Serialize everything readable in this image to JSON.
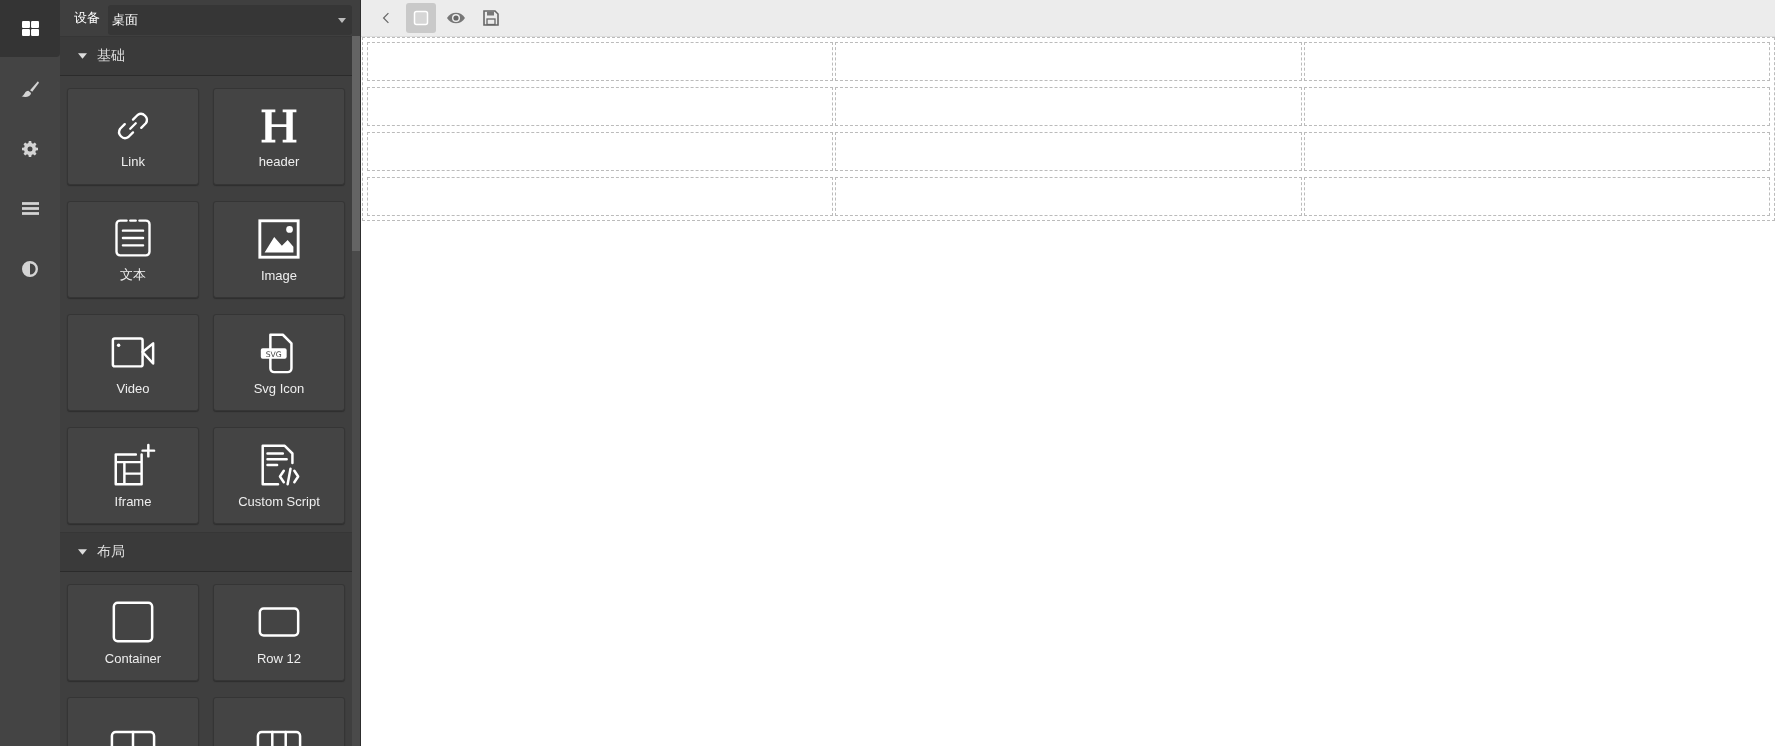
{
  "icon_bar": [
    {
      "kind": "blocks",
      "selected": true
    },
    {
      "kind": "brush",
      "selected": false
    },
    {
      "kind": "gear",
      "selected": false
    },
    {
      "kind": "bars",
      "selected": false
    },
    {
      "kind": "contrast",
      "selected": false
    }
  ],
  "device": {
    "label": "设备",
    "value": "桌面"
  },
  "categories": [
    {
      "title": "基础",
      "expanded": true,
      "blocks": [
        {
          "kind": "link",
          "label": "Link"
        },
        {
          "kind": "heading",
          "label": "header"
        },
        {
          "kind": "text",
          "label": "文本"
        },
        {
          "kind": "image",
          "label": "Image"
        },
        {
          "kind": "video",
          "label": "Video"
        },
        {
          "kind": "svg",
          "label": "Svg Icon",
          "badge": "SVG"
        },
        {
          "kind": "iframe",
          "label": "Iframe"
        },
        {
          "kind": "script",
          "label": "Custom Script"
        }
      ]
    },
    {
      "title": "布局",
      "expanded": true,
      "blocks": [
        {
          "kind": "container",
          "label": "Container"
        },
        {
          "kind": "row",
          "label": "Row 12"
        },
        {
          "kind": "cols2"
        },
        {
          "kind": "cols3"
        }
      ]
    }
  ],
  "toolbar": [
    {
      "kind": "back",
      "selected": false
    },
    {
      "kind": "outline",
      "selected": true
    },
    {
      "kind": "preview",
      "selected": false
    },
    {
      "kind": "save",
      "selected": false
    }
  ],
  "canvas": {
    "rows": [
      {
        "cells": [
          {
            "kind": "cell"
          },
          {
            "kind": "cell"
          },
          {
            "kind": "cell"
          }
        ]
      },
      {
        "cells": [
          {
            "kind": "cell"
          },
          {
            "kind": "cell"
          },
          {
            "kind": "cell"
          }
        ]
      },
      {
        "cells": [
          {
            "kind": "cell"
          },
          {
            "kind": "cell"
          },
          {
            "kind": "cell"
          }
        ]
      },
      {
        "cells": [
          {
            "kind": "cell"
          },
          {
            "kind": "cell"
          },
          {
            "kind": "cell"
          }
        ]
      }
    ]
  }
}
